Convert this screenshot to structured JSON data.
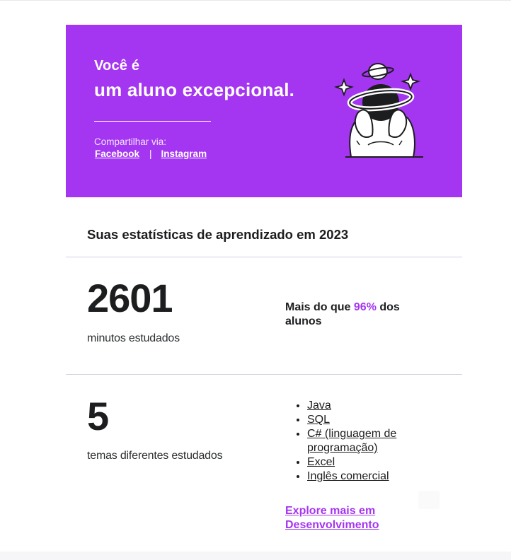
{
  "hero": {
    "line1": "Você é",
    "line2": "um aluno excepcional.",
    "share_label": "Compartilhar via:",
    "share_links": [
      "Facebook",
      "Instagram"
    ],
    "share_separator": "|",
    "illustration_icon": "astronaut-planet-illustration",
    "background_color": "#a435f0"
  },
  "stats": {
    "title": "Suas estatísticas de aprendizado em 2023",
    "minutes": {
      "value": "2601",
      "label": "minutos estudados",
      "comparison_prefix": "Mais do que ",
      "comparison_percent": "96%",
      "comparison_suffix": " dos alunos"
    },
    "topics": {
      "value": "5",
      "label": "temas diferentes estudados",
      "items": [
        "Java",
        "SQL",
        "C# (linguagem de programação)",
        "Excel",
        "Inglês comercial"
      ],
      "explore_link": "Explore mais em Desenvolvimento"
    }
  },
  "colors": {
    "accent": "#a435f0",
    "text": "#1c1d1f",
    "divider": "#d1d2e0"
  }
}
